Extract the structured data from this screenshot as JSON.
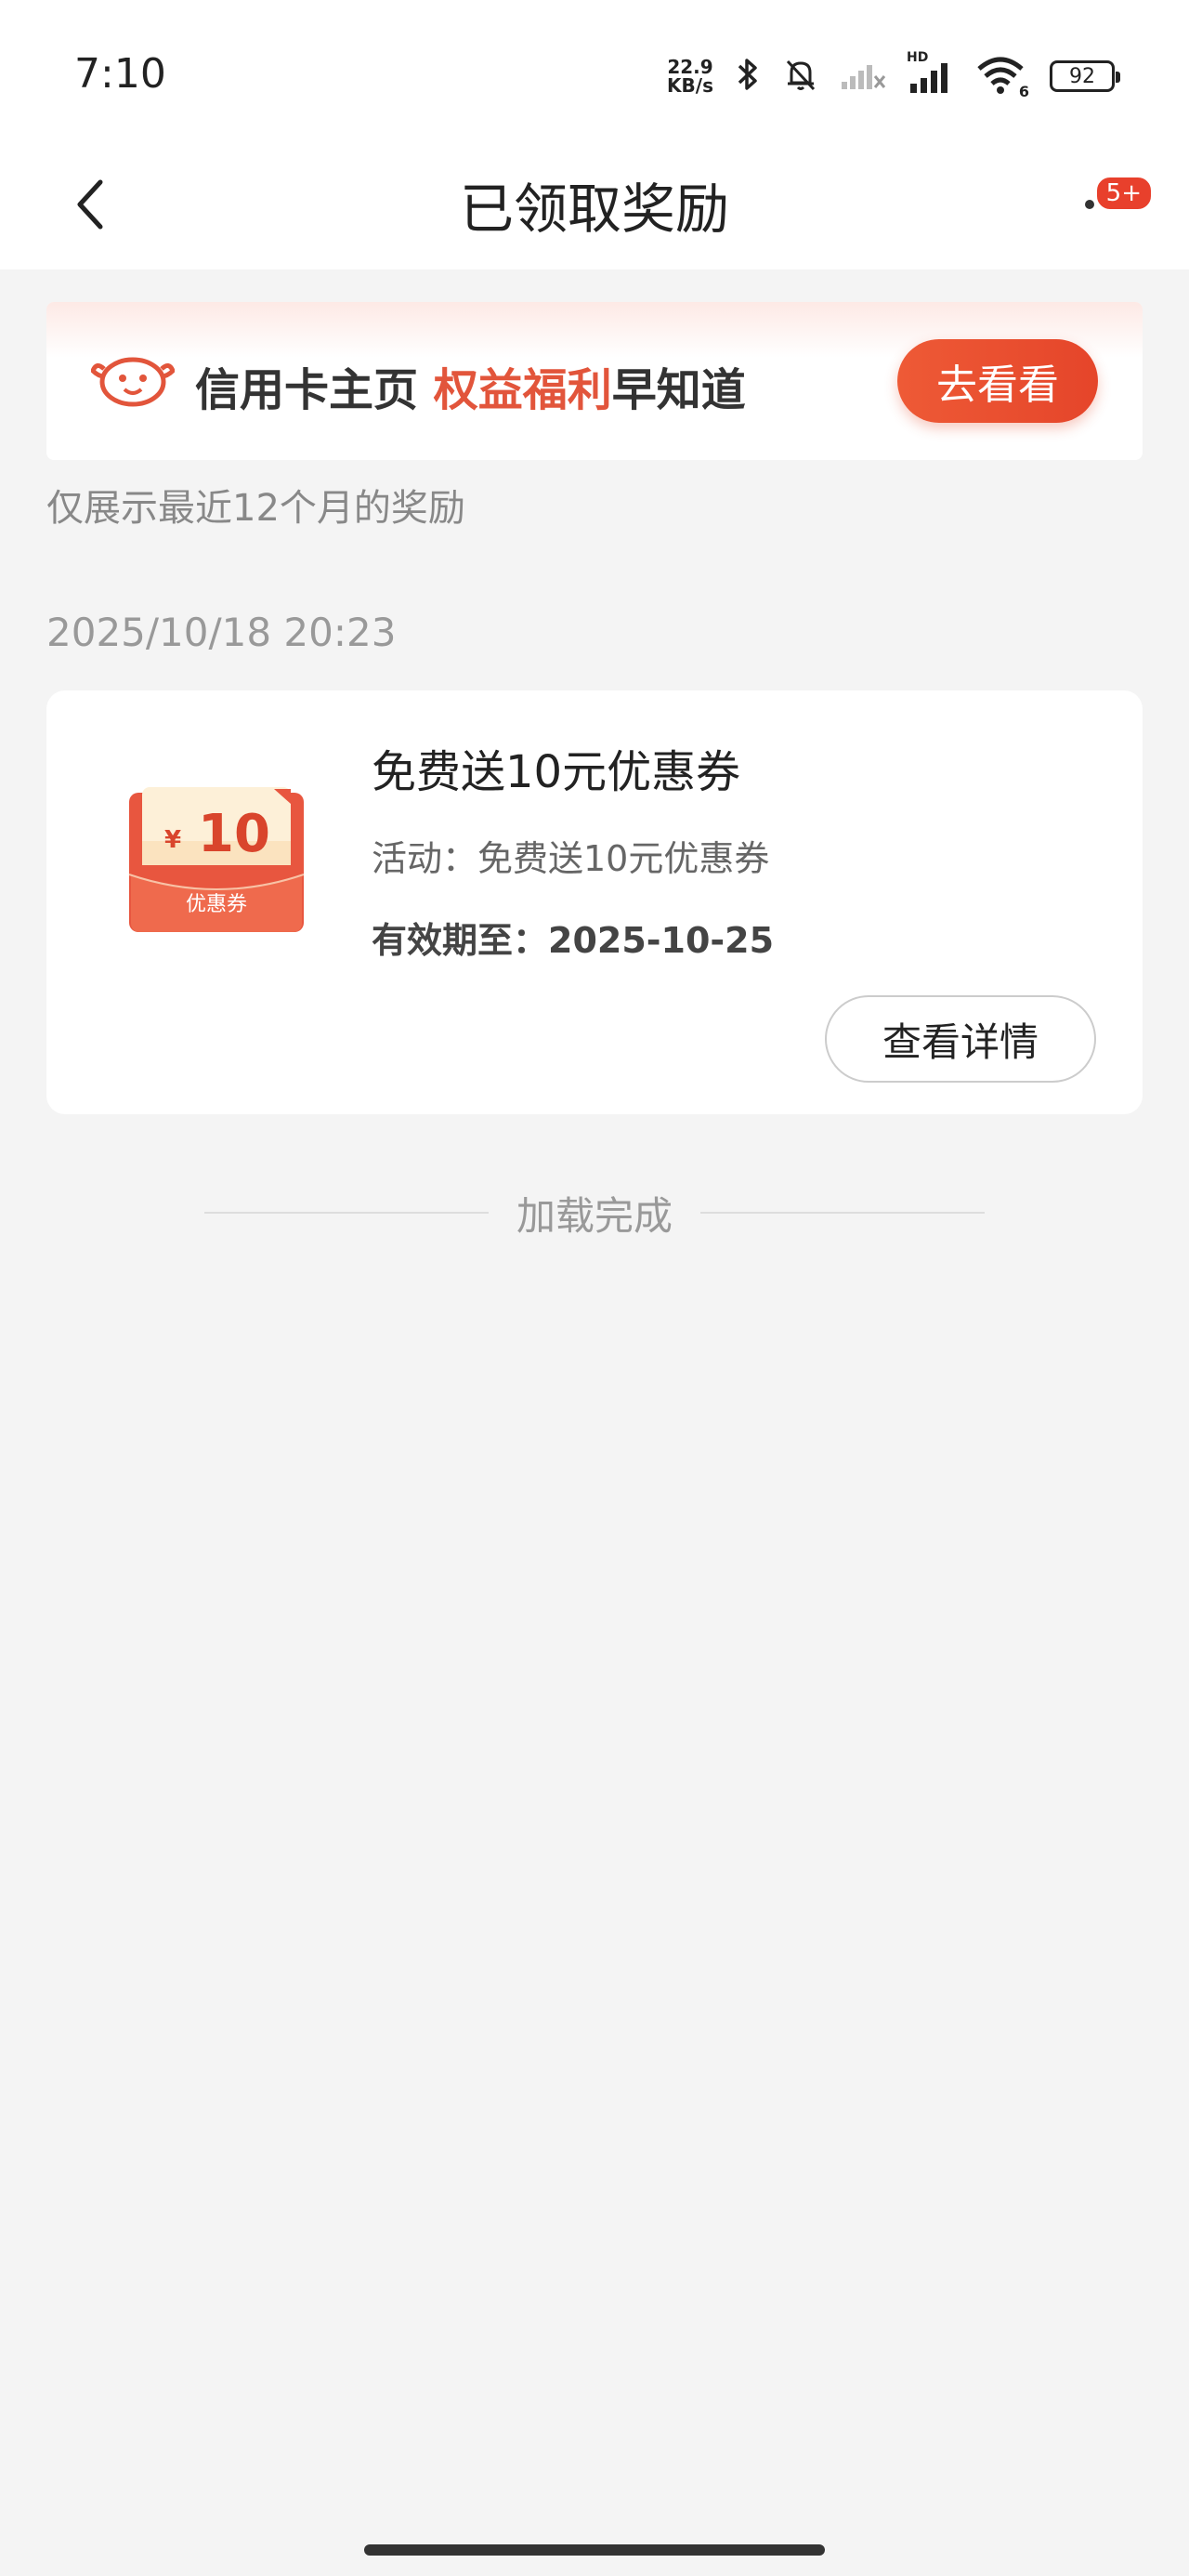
{
  "status_bar": {
    "time": "7:10",
    "net_speed_value": "22.9",
    "net_speed_unit": "KB/s",
    "signal_label": "HD",
    "wifi_label": "6",
    "battery": "92"
  },
  "navbar": {
    "title": "已领取奖励",
    "more_badge": "5+"
  },
  "banner": {
    "text_dark_1": "信用卡主页 ",
    "text_red": "权益福利",
    "text_dark_2": "早知道",
    "button": "去看看"
  },
  "hint": "仅展示最近12个月的奖励",
  "records": [
    {
      "date": "2025/10/18 20:23",
      "coupon_amount": "10",
      "coupon_currency": "¥",
      "coupon_label": "优惠券",
      "title": "免费送10元优惠券",
      "activity": "活动：免费送10元优惠券",
      "expiry": "有效期至：2025-10-25",
      "button": "查看详情"
    }
  ],
  "loading_done": "加载完成",
  "colors": {
    "accent": "#e5452a",
    "background": "#f4f4f4",
    "badge": "#e8402c"
  }
}
